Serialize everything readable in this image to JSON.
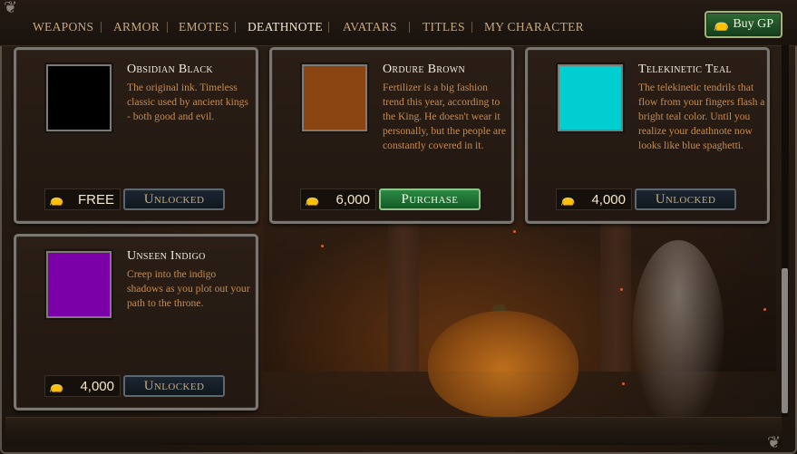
{
  "nav": {
    "tabs": [
      {
        "label": "WEAPONS",
        "active": false
      },
      {
        "label": "ARMOR",
        "active": false
      },
      {
        "label": "EMOTES",
        "active": false
      },
      {
        "label": "DEATHNOTE",
        "active": true
      },
      {
        "label": "AVATARS",
        "active": false
      },
      {
        "label": "TITLES",
        "active": false
      },
      {
        "label": "MY CHARACTER",
        "active": false
      }
    ],
    "buy_gp_label": "Buy GP"
  },
  "items": [
    {
      "name": "Obsidian Black",
      "description": "The original ink. Timeless classic used by ancient kings - both good and evil.",
      "color": "#000000",
      "price": "FREE",
      "button_label": "Unlocked",
      "button_state": "unlocked"
    },
    {
      "name": "Ordure Brown",
      "description": "Fertilizer is a big fashion trend this year, according to the King. He doesn't wear it personally, but the people are constantly covered in it.",
      "color": "#8b4513",
      "price": "6,000",
      "button_label": "Purchase",
      "button_state": "purchase"
    },
    {
      "name": "Telekinetic Teal",
      "description": "The telekinetic tendrils that flow from your fingers flash a bright teal color. Until you realize your deathnote now looks like blue spaghetti.",
      "color": "#00ced1",
      "price": "4,000",
      "button_label": "Unlocked",
      "button_state": "unlocked"
    },
    {
      "name": "Unseen Indigo",
      "description": "Creep into the indigo shadows as you plot out your path to the throne.",
      "color": "#7b00a8",
      "price": "4,000",
      "button_label": "Unlocked",
      "button_state": "unlocked"
    }
  ],
  "icons": {
    "currency": "money-bag-icon",
    "buy_gp": "money-bag-icon"
  },
  "colors": {
    "accent_gold": "#c9a87a",
    "purchase_green": "#2c8a44",
    "description_orange": "#c98a4e"
  }
}
